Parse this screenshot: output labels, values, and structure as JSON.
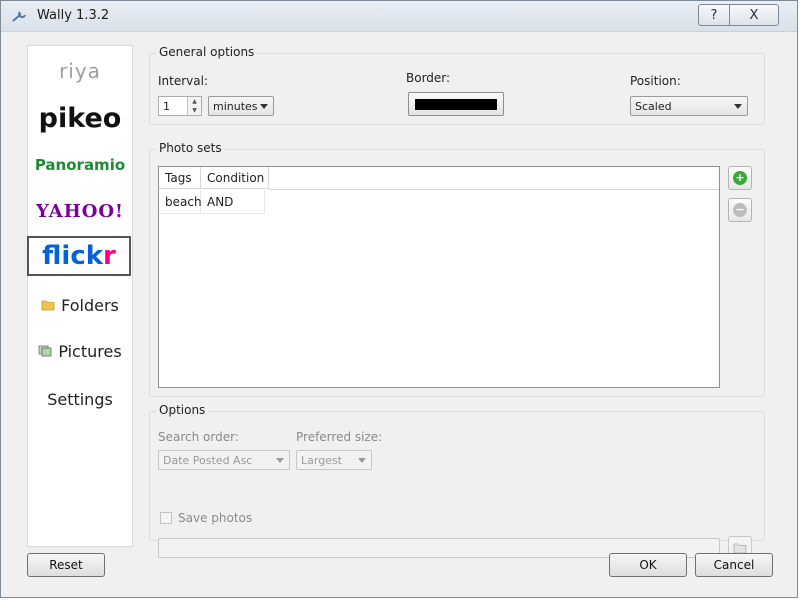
{
  "window": {
    "title": "Wally 1.3.2",
    "help_glyph": "?",
    "close_glyph": "X"
  },
  "sidebar": {
    "items": [
      {
        "label": "riya",
        "icon": "riya-logo"
      },
      {
        "label": "pikeo",
        "icon": "pikeo-logo"
      },
      {
        "label": "Panoramio",
        "icon": "panoramio-logo"
      },
      {
        "label": "YAHOO!",
        "icon": "yahoo-logo"
      },
      {
        "label_main": "flick",
        "label_accent": "r",
        "icon": "flickr-logo",
        "selected": true
      },
      {
        "label": "Folders",
        "icon": "folder-icon"
      },
      {
        "label": "Pictures",
        "icon": "pictures-icon"
      },
      {
        "label": "Settings"
      }
    ]
  },
  "general": {
    "title": "General options",
    "interval_label": "Interval:",
    "interval_value": "1",
    "interval_unit": "minutes",
    "border_label": "Border:",
    "border_color": "#000000",
    "position_label": "Position:",
    "position_value": "Scaled"
  },
  "photo_sets": {
    "title": "Photo sets",
    "columns": [
      "Tags",
      "Condition"
    ],
    "rows": [
      {
        "tags": "beach",
        "condition": "AND"
      }
    ]
  },
  "options": {
    "title": "Options",
    "search_order_label": "Search order:",
    "search_order_value": "Date Posted Asc",
    "preferred_size_label": "Preferred size:",
    "preferred_size_value": "Largest",
    "save_photos_label": "Save photos",
    "save_photos_checked": false,
    "save_path": ""
  },
  "buttons": {
    "reset": "Reset",
    "ok": "OK",
    "cancel": "Cancel"
  },
  "colors": {
    "add_green": "#3aa83a",
    "remove_gray": "#bdbdbd",
    "flickr_blue": "#0063dc",
    "flickr_pink": "#ff0084"
  }
}
